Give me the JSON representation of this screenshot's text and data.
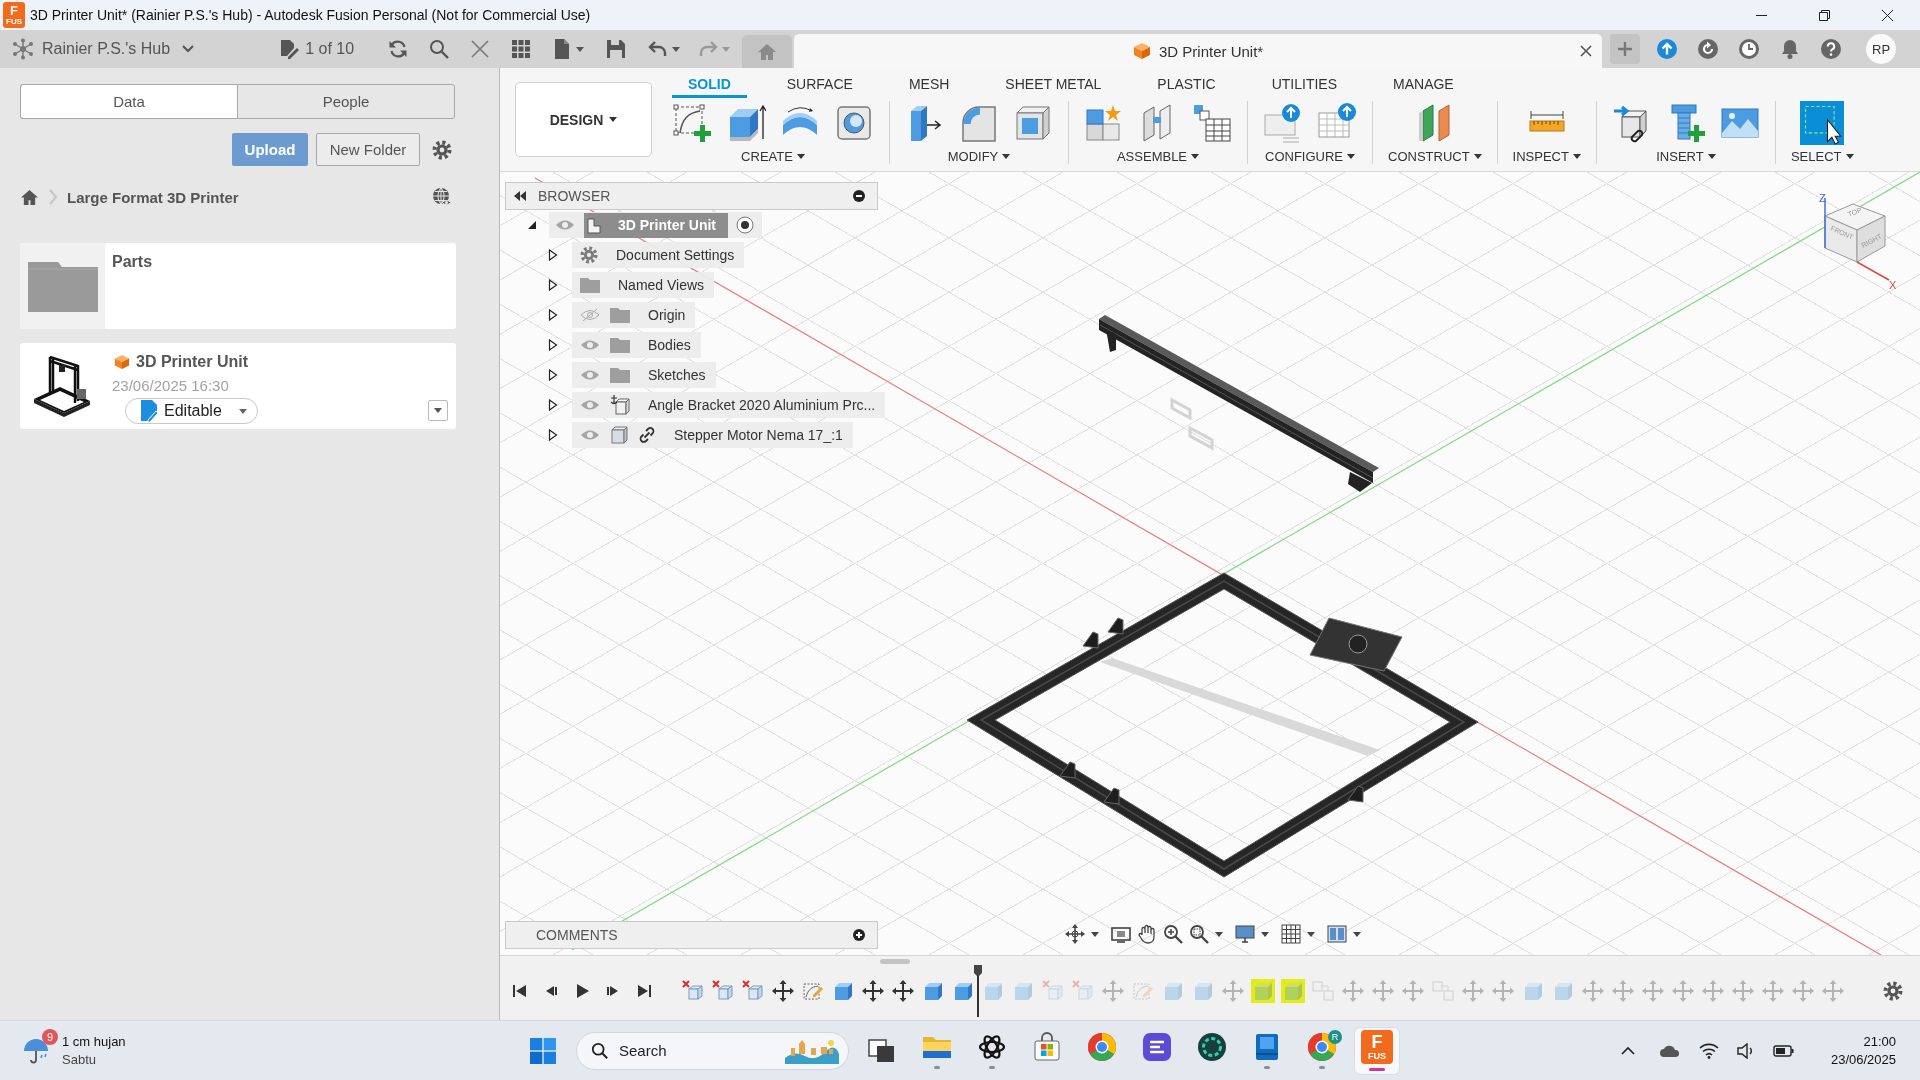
{
  "window": {
    "title": "3D Printer Unit* (Rainier P.S.'s Hub) - Autodesk Fusion Personal (Not for Commercial Use)",
    "logo": {
      "letter": "F",
      "caption": "FUS"
    }
  },
  "hub_bar": {
    "hub_name": "Rainier P.S.'s Hub",
    "version": "1 of 10"
  },
  "document_tab": {
    "title": "3D Printer Unit*"
  },
  "user": {
    "initials": "RP"
  },
  "data_panel": {
    "tabs": [
      {
        "label": "Data",
        "selected": true
      },
      {
        "label": "People",
        "selected": false
      }
    ],
    "upload_button": "Upload",
    "new_folder_button": "New Folder",
    "breadcrumb": "Large Format 3D Printer",
    "items": [
      {
        "kind": "folder",
        "name": "Parts"
      },
      {
        "kind": "design",
        "name": "3D Printer Unit",
        "date": "23/06/2025 16:30",
        "status": "Editable"
      }
    ]
  },
  "ribbon": {
    "workspace": "DESIGN",
    "tabs": [
      {
        "label": "SOLID",
        "selected": true
      },
      {
        "label": "SURFACE",
        "selected": false
      },
      {
        "label": "MESH",
        "selected": false
      },
      {
        "label": "SHEET METAL",
        "selected": false
      },
      {
        "label": "PLASTIC",
        "selected": false
      },
      {
        "label": "UTILITIES",
        "selected": false
      },
      {
        "label": "MANAGE",
        "selected": false
      }
    ],
    "groups": [
      {
        "label": "CREATE"
      },
      {
        "label": "MODIFY"
      },
      {
        "label": "ASSEMBLE"
      },
      {
        "label": "CONFIGURE"
      },
      {
        "label": "CONSTRUCT"
      },
      {
        "label": "INSPECT"
      },
      {
        "label": "INSERT"
      },
      {
        "label": "SELECT"
      }
    ]
  },
  "browser": {
    "title": "BROWSER",
    "root": {
      "label": "3D Printer Unit",
      "expanded": true,
      "visible": true,
      "active": true,
      "children": [
        {
          "label": "Document Settings",
          "kind": "settings",
          "expanded": false
        },
        {
          "label": "Named Views",
          "kind": "views",
          "expanded": false
        },
        {
          "label": "Origin",
          "kind": "folder",
          "expanded": false,
          "visible": false
        },
        {
          "label": "Bodies",
          "kind": "folder",
          "expanded": false,
          "visible": true
        },
        {
          "label": "Sketches",
          "kind": "folder",
          "expanded": false,
          "visible": true
        },
        {
          "label": "Angle Bracket 2020 Aluminium Prc...",
          "kind": "component",
          "expanded": false,
          "visible": true
        },
        {
          "label": "Stepper Motor Nema 17_:1",
          "kind": "linked_component",
          "expanded": false,
          "visible": true
        }
      ]
    }
  },
  "comments": {
    "title": "COMMENTS"
  },
  "view_cube": {
    "faces": [
      "TOP",
      "FRONT",
      "RIGHT"
    ],
    "axes": [
      "Z",
      "X"
    ]
  },
  "timeline": {
    "items": [
      {
        "kind": "delete",
        "rolled_back": false,
        "highlighted": false
      },
      {
        "kind": "delete",
        "rolled_back": false,
        "highlighted": false
      },
      {
        "kind": "delete",
        "rolled_back": false,
        "highlighted": false
      },
      {
        "kind": "move",
        "rolled_back": false,
        "highlighted": false
      },
      {
        "kind": "sketch",
        "rolled_back": false,
        "highlighted": false
      },
      {
        "kind": "body",
        "rolled_back": false,
        "highlighted": false
      },
      {
        "kind": "move",
        "rolled_back": false,
        "highlighted": false
      },
      {
        "kind": "move",
        "rolled_back": false,
        "highlighted": false
      },
      {
        "kind": "body",
        "rolled_back": false,
        "highlighted": false
      },
      {
        "kind": "body",
        "rolled_back": false,
        "highlighted": false
      },
      {
        "kind": "body",
        "rolled_back": true,
        "highlighted": false
      },
      {
        "kind": "body",
        "rolled_back": true,
        "highlighted": false
      },
      {
        "kind": "delete",
        "rolled_back": true,
        "highlighted": false
      },
      {
        "kind": "delete",
        "rolled_back": true,
        "highlighted": false
      },
      {
        "kind": "move",
        "rolled_back": true,
        "highlighted": false
      },
      {
        "kind": "sketch",
        "rolled_back": true,
        "highlighted": false
      },
      {
        "kind": "body",
        "rolled_back": true,
        "highlighted": false
      },
      {
        "kind": "body",
        "rolled_back": true,
        "highlighted": false
      },
      {
        "kind": "move",
        "rolled_back": true,
        "highlighted": false
      },
      {
        "kind": "body",
        "rolled_back": true,
        "highlighted": true
      },
      {
        "kind": "body",
        "rolled_back": true,
        "highlighted": true
      },
      {
        "kind": "joint",
        "rolled_back": true,
        "highlighted": false
      },
      {
        "kind": "move",
        "rolled_back": true,
        "highlighted": false
      },
      {
        "kind": "move",
        "rolled_back": true,
        "highlighted": false
      },
      {
        "kind": "move",
        "rolled_back": true,
        "highlighted": false
      },
      {
        "kind": "joint",
        "rolled_back": true,
        "highlighted": false
      },
      {
        "kind": "move",
        "rolled_back": true,
        "highlighted": false
      },
      {
        "kind": "move",
        "rolled_back": true,
        "highlighted": false
      },
      {
        "kind": "body",
        "rolled_back": true,
        "highlighted": false
      },
      {
        "kind": "body",
        "rolled_back": true,
        "highlighted": false
      },
      {
        "kind": "move",
        "rolled_back": true,
        "highlighted": false
      },
      {
        "kind": "move",
        "rolled_back": true,
        "highlighted": false
      },
      {
        "kind": "move",
        "rolled_back": true,
        "highlighted": false
      },
      {
        "kind": "move",
        "rolled_back": true,
        "highlighted": false
      },
      {
        "kind": "move",
        "rolled_back": true,
        "highlighted": false
      },
      {
        "kind": "move",
        "rolled_back": true,
        "highlighted": false
      },
      {
        "kind": "move",
        "rolled_back": true,
        "highlighted": false
      },
      {
        "kind": "move",
        "rolled_back": true,
        "highlighted": false
      },
      {
        "kind": "move",
        "rolled_back": true,
        "highlighted": false
      }
    ]
  },
  "taskbar": {
    "weather": {
      "badge": "9",
      "condition": "1 cm hujan",
      "day": "Sabtu"
    },
    "search": {
      "placeholder": "Search"
    },
    "apps": [
      {
        "running": true,
        "selected": false
      },
      {
        "running": true,
        "selected": false
      },
      {
        "running": false,
        "selected": false
      },
      {
        "running": false,
        "selected": false
      },
      {
        "running": false,
        "selected": false
      },
      {
        "running": false,
        "selected": false
      },
      {
        "running": true,
        "selected": false
      },
      {
        "running": true,
        "selected": false,
        "badge": "R"
      },
      {
        "running": true,
        "selected": true,
        "logo": {
          "letter": "F",
          "caption": "FUS"
        }
      }
    ],
    "clock": {
      "time": "21:00",
      "date": "23/06/2025"
    }
  }
}
